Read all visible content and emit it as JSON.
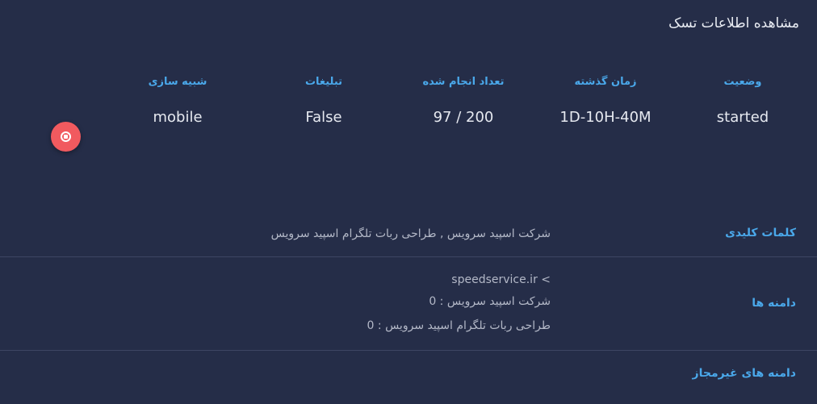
{
  "page": {
    "title": "مشاهده اطلاعات تسک"
  },
  "stats": [
    {
      "label": "وضعیت",
      "value": "started"
    },
    {
      "label": "زمان گذشته",
      "value": "1D-10H-40M"
    },
    {
      "label": "تعداد انجام شده",
      "value": "97 / 200"
    },
    {
      "label": "تبلیغات",
      "value": "False"
    },
    {
      "label": "شبیه سازی",
      "value": "mobile"
    }
  ],
  "keywords": {
    "label": "کلمات کلیدی",
    "value": "شرکت اسپید سرویس , طراحی ربات تلگرام اسپید سرویس"
  },
  "domains": {
    "label": "دامنه ها",
    "items": [
      "speedservice.ir <",
      "شرکت اسپید سرویس : 0",
      "طراحی ربات تلگرام اسپید سرویس : 0"
    ]
  },
  "invalid_domains": {
    "label": "دامنه های غیرمجاز"
  },
  "colors": {
    "background": "#252d48",
    "accent": "#4aa8ea",
    "stop_button": "#f15a5f",
    "divider": "#3d4563"
  },
  "icons": {
    "stop_button": "stop-circle-icon"
  }
}
